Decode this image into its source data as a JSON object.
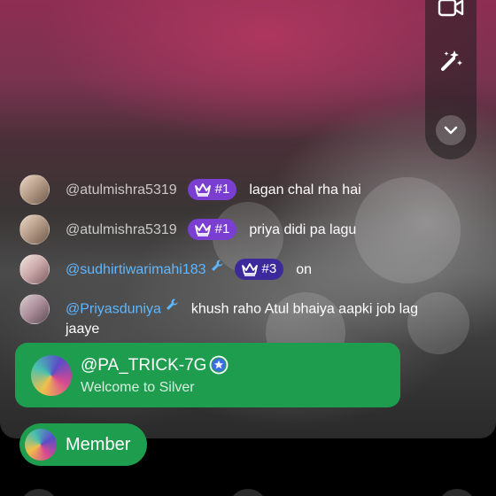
{
  "chat": [
    {
      "username": "@atulmishra5319",
      "badge": "#1",
      "message": "lagan chal rha hai"
    },
    {
      "username": "@atulmishra5319",
      "badge": "#1",
      "message": "priya didi pa lagu"
    },
    {
      "username": "@sudhirtiwarimahi183",
      "badge": "#3",
      "message": "on"
    },
    {
      "username": "@Priyasduniya",
      "message": "khush raho Atul bhaiya aapki job lag jaaye"
    }
  ],
  "welcome": {
    "name": "@PA_TRICK-7G",
    "subtitle": "Welcome to Silver"
  },
  "member": {
    "label": "Member"
  },
  "controls": {
    "icons": [
      "video-camera-icon",
      "magic-wand-icon",
      "chevron-down-icon"
    ]
  },
  "colors": {
    "accent_green": "#1f9d4e",
    "badge_purple": "#7a3fd1",
    "badge_dark": "#3c2a9d",
    "mention_blue": "#5eb6ff"
  }
}
